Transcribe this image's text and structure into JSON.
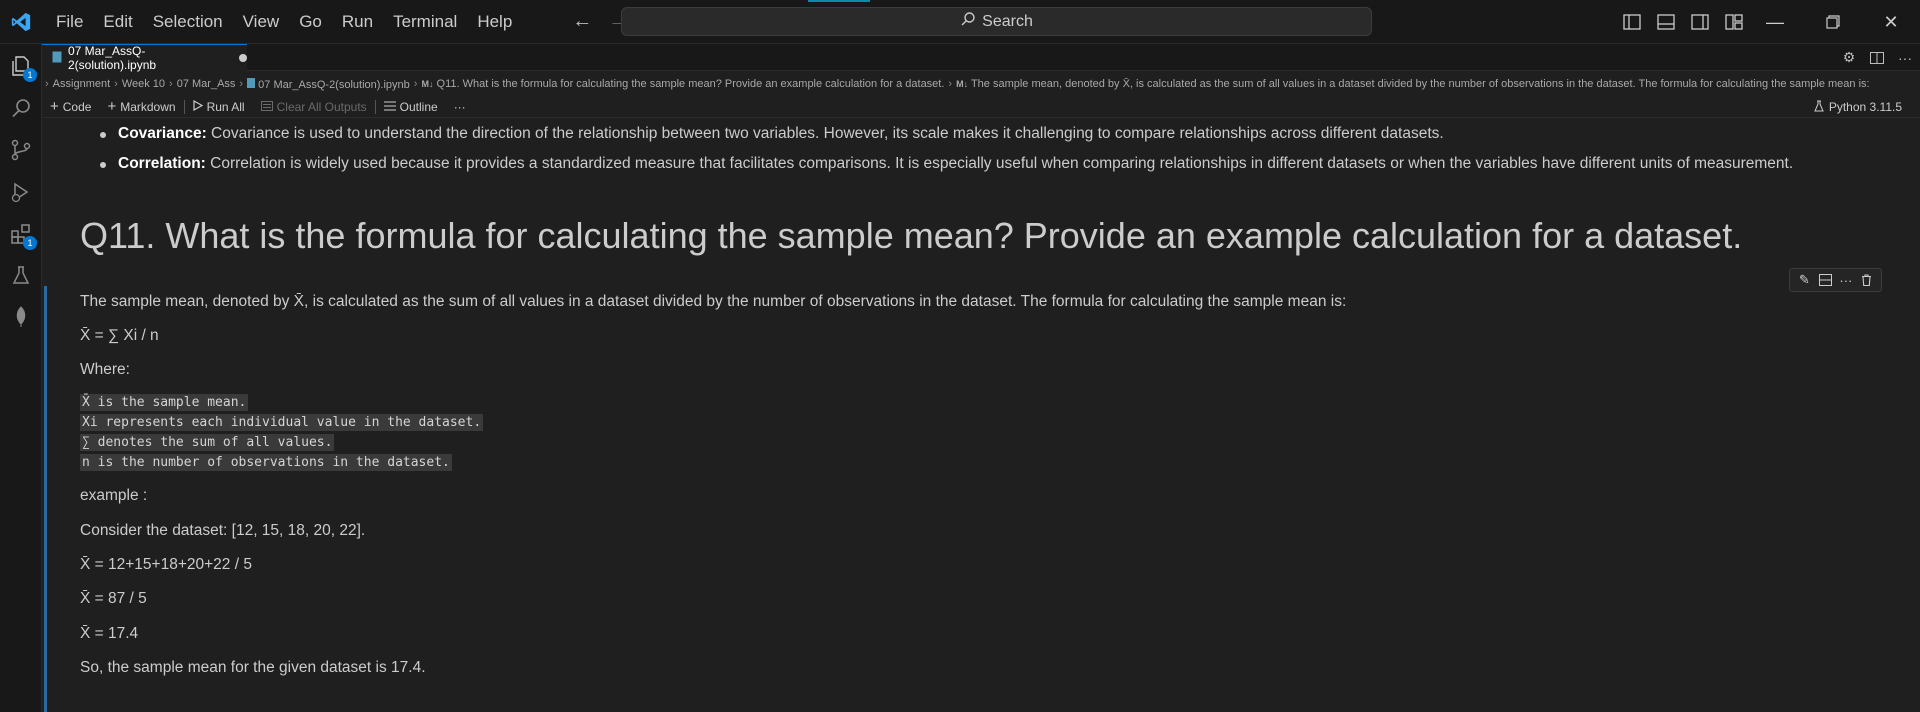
{
  "menu": [
    "File",
    "Edit",
    "Selection",
    "View",
    "Go",
    "Run",
    "Terminal",
    "Help"
  ],
  "search": {
    "placeholder": "Search"
  },
  "activity_badges": {
    "explorer": "1",
    "extensions": "1"
  },
  "tab": {
    "label": "07 Mar_AssQ-2(solution).ipynb"
  },
  "breadcrumb": [
    "Assignment",
    "Week 10",
    "07 Mar_Ass",
    "07 Mar_AssQ-2(solution).ipynb",
    "Q11. What is the formula for calculating the sample mean? Provide an example calculation for a dataset.",
    "The sample mean, denoted by X̄, is calculated as the sum of all values in a dataset divided by the number of observations in the dataset. The formula for calculating the sample mean is:"
  ],
  "toolbar": {
    "code": "Code",
    "markdown": "Markdown",
    "run_all": "Run All",
    "clear_outputs": "Clear All Outputs",
    "outline": "Outline",
    "more": "···",
    "kernel": "Python 3.11.5"
  },
  "bullets": [
    {
      "term": "Covariance:",
      "text": " Covariance is used to understand the direction of the relationship between two variables. However, its scale makes it challenging to compare relationships across different datasets."
    },
    {
      "term": "Correlation:",
      "text": " Correlation is widely used because it provides a standardized measure that facilitates comparisons. It is especially useful when comparing relationships in different datasets or when the variables have different units of measurement."
    }
  ],
  "heading": "Q11. What is the formula for calculating the sample mean? Provide an example calculation for a dataset.",
  "cell": {
    "intro": "The sample mean, denoted by X̄, is calculated as the sum of all values in a dataset divided by the number of observations in the dataset. The formula for calculating the sample mean is:",
    "formula": "X̄ = ∑ Xi / n",
    "where": "Where:",
    "code_lines": [
      "X̄ is the sample mean.",
      "Xi represents each individual value in the dataset.",
      "∑ denotes the sum of all values.",
      "n is the number of observations in the dataset."
    ],
    "example_label": "example :",
    "dataset": "Consider the dataset: [12, 15, 18, 20, 22].",
    "calc1": "X̄ = 12+15+18+20+22 / 5",
    "calc2": "X̄ = 87 / 5",
    "calc3": "X̄ = 17.4",
    "conclusion": "So, the sample mean for the given dataset is 17.4."
  },
  "colors": {
    "accent": "#0078d4",
    "cell_bar": "#2b6aa0",
    "logo": "#3ba7f3"
  }
}
